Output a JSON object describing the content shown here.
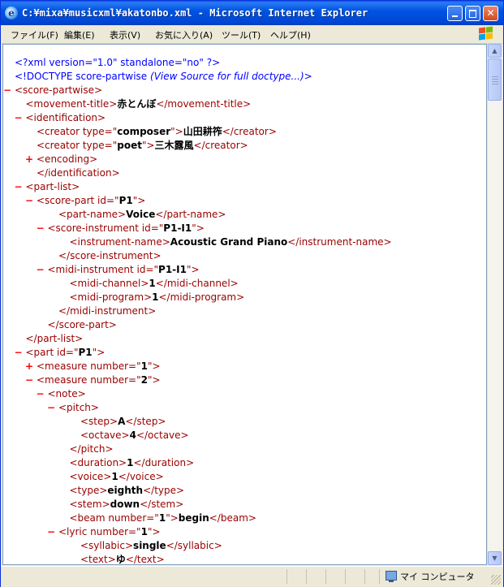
{
  "window": {
    "title": "C:¥mixa¥musicxml¥akatonbo.xml - Microsoft Internet Explorer"
  },
  "menu": [
    "ファイル(F)",
    "編集(E)",
    "表示(V)",
    "お気に入り(A)",
    "ツール(T)",
    "ヘルプ(H)"
  ],
  "status": {
    "zone": "マイ コンピュータ"
  },
  "xml_lines": [
    {
      "indent": 0,
      "marker": "",
      "parts": [
        [
          "pi",
          "<?xml version=\"1.0\" standalone=\"no\" ?>"
        ]
      ]
    },
    {
      "indent": 0,
      "marker": "",
      "parts": [
        [
          "pi",
          "<!DOCTYPE score-partwise "
        ],
        [
          "comment",
          "(View Source for full doctype...)"
        ],
        [
          "pi",
          ">"
        ]
      ]
    },
    {
      "indent": 0,
      "marker": "-",
      "parts": [
        [
          "tag",
          "<score-partwise>"
        ]
      ]
    },
    {
      "indent": 1,
      "marker": "",
      "parts": [
        [
          "tag",
          "<movement-title>"
        ],
        [
          "text",
          "赤とんぼ"
        ],
        [
          "tag",
          "</movement-title>"
        ]
      ]
    },
    {
      "indent": 1,
      "marker": "-",
      "parts": [
        [
          "tag",
          "<identification>"
        ]
      ]
    },
    {
      "indent": 2,
      "marker": "",
      "parts": [
        [
          "tag",
          "<creator type=\""
        ],
        [
          "val",
          "composer"
        ],
        [
          "tag",
          "\">"
        ],
        [
          "text",
          "山田耕筰"
        ],
        [
          "tag",
          "</creator>"
        ]
      ]
    },
    {
      "indent": 2,
      "marker": "",
      "parts": [
        [
          "tag",
          "<creator type=\""
        ],
        [
          "val",
          "poet"
        ],
        [
          "tag",
          "\">"
        ],
        [
          "text",
          "三木露風"
        ],
        [
          "tag",
          "</creator>"
        ]
      ]
    },
    {
      "indent": 2,
      "marker": "+",
      "parts": [
        [
          "tag",
          "<encoding>"
        ]
      ]
    },
    {
      "indent": 2,
      "marker": "",
      "parts": [
        [
          "tag",
          "</identification>"
        ]
      ]
    },
    {
      "indent": 1,
      "marker": "-",
      "parts": [
        [
          "tag",
          "<part-list>"
        ]
      ]
    },
    {
      "indent": 2,
      "marker": "-",
      "parts": [
        [
          "tag",
          "<score-part id=\""
        ],
        [
          "val",
          "P1"
        ],
        [
          "tag",
          "\">"
        ]
      ]
    },
    {
      "indent": 4,
      "marker": "",
      "parts": [
        [
          "tag",
          "<part-name>"
        ],
        [
          "text",
          "Voice"
        ],
        [
          "tag",
          "</part-name>"
        ]
      ]
    },
    {
      "indent": 3,
      "marker": "-",
      "parts": [
        [
          "tag",
          "<score-instrument id=\""
        ],
        [
          "val",
          "P1-I1"
        ],
        [
          "tag",
          "\">"
        ]
      ]
    },
    {
      "indent": 5,
      "marker": "",
      "parts": [
        [
          "tag",
          "<instrument-name>"
        ],
        [
          "text",
          "Acoustic Grand Piano"
        ],
        [
          "tag",
          "</instrument-name>"
        ]
      ]
    },
    {
      "indent": 4,
      "marker": "",
      "parts": [
        [
          "tag",
          "</score-instrument>"
        ]
      ]
    },
    {
      "indent": 3,
      "marker": "-",
      "parts": [
        [
          "tag",
          "<midi-instrument id=\""
        ],
        [
          "val",
          "P1-I1"
        ],
        [
          "tag",
          "\">"
        ]
      ]
    },
    {
      "indent": 5,
      "marker": "",
      "parts": [
        [
          "tag",
          "<midi-channel>"
        ],
        [
          "text",
          "1"
        ],
        [
          "tag",
          "</midi-channel>"
        ]
      ]
    },
    {
      "indent": 5,
      "marker": "",
      "parts": [
        [
          "tag",
          "<midi-program>"
        ],
        [
          "text",
          "1"
        ],
        [
          "tag",
          "</midi-program>"
        ]
      ]
    },
    {
      "indent": 4,
      "marker": "",
      "parts": [
        [
          "tag",
          "</midi-instrument>"
        ]
      ]
    },
    {
      "indent": 3,
      "marker": "",
      "parts": [
        [
          "tag",
          "</score-part>"
        ]
      ]
    },
    {
      "indent": 1,
      "marker": "",
      "parts": [
        [
          "tag",
          "</part-list>"
        ]
      ]
    },
    {
      "indent": 1,
      "marker": "-",
      "parts": [
        [
          "tag",
          "<part id=\""
        ],
        [
          "val",
          "P1"
        ],
        [
          "tag",
          "\">"
        ]
      ]
    },
    {
      "indent": 2,
      "marker": "+",
      "parts": [
        [
          "tag",
          "<measure number=\""
        ],
        [
          "val",
          "1"
        ],
        [
          "tag",
          "\">"
        ]
      ]
    },
    {
      "indent": 2,
      "marker": "-",
      "parts": [
        [
          "tag",
          "<measure number=\""
        ],
        [
          "val",
          "2"
        ],
        [
          "tag",
          "\">"
        ]
      ]
    },
    {
      "indent": 3,
      "marker": "-",
      "parts": [
        [
          "tag",
          "<note>"
        ]
      ]
    },
    {
      "indent": 4,
      "marker": "-",
      "parts": [
        [
          "tag",
          "<pitch>"
        ]
      ]
    },
    {
      "indent": 6,
      "marker": "",
      "parts": [
        [
          "tag",
          "<step>"
        ],
        [
          "text",
          "A"
        ],
        [
          "tag",
          "</step>"
        ]
      ]
    },
    {
      "indent": 6,
      "marker": "",
      "parts": [
        [
          "tag",
          "<octave>"
        ],
        [
          "text",
          "4"
        ],
        [
          "tag",
          "</octave>"
        ]
      ]
    },
    {
      "indent": 5,
      "marker": "",
      "parts": [
        [
          "tag",
          "</pitch>"
        ]
      ]
    },
    {
      "indent": 5,
      "marker": "",
      "parts": [
        [
          "tag",
          "<duration>"
        ],
        [
          "text",
          "1"
        ],
        [
          "tag",
          "</duration>"
        ]
      ]
    },
    {
      "indent": 5,
      "marker": "",
      "parts": [
        [
          "tag",
          "<voice>"
        ],
        [
          "text",
          "1"
        ],
        [
          "tag",
          "</voice>"
        ]
      ]
    },
    {
      "indent": 5,
      "marker": "",
      "parts": [
        [
          "tag",
          "<type>"
        ],
        [
          "text",
          "eighth"
        ],
        [
          "tag",
          "</type>"
        ]
      ]
    },
    {
      "indent": 5,
      "marker": "",
      "parts": [
        [
          "tag",
          "<stem>"
        ],
        [
          "text",
          "down"
        ],
        [
          "tag",
          "</stem>"
        ]
      ]
    },
    {
      "indent": 5,
      "marker": "",
      "parts": [
        [
          "tag",
          "<beam number=\""
        ],
        [
          "val",
          "1"
        ],
        [
          "tag",
          "\">"
        ],
        [
          "text",
          "begin"
        ],
        [
          "tag",
          "</beam>"
        ]
      ]
    },
    {
      "indent": 4,
      "marker": "-",
      "parts": [
        [
          "tag",
          "<lyric number=\""
        ],
        [
          "val",
          "1"
        ],
        [
          "tag",
          "\">"
        ]
      ]
    },
    {
      "indent": 6,
      "marker": "",
      "parts": [
        [
          "tag",
          "<syllabic>"
        ],
        [
          "text",
          "single"
        ],
        [
          "tag",
          "</syllabic>"
        ]
      ]
    },
    {
      "indent": 6,
      "marker": "",
      "parts": [
        [
          "tag",
          "<text>"
        ],
        [
          "text",
          "ゆ"
        ],
        [
          "tag",
          "</text>"
        ]
      ]
    }
  ]
}
